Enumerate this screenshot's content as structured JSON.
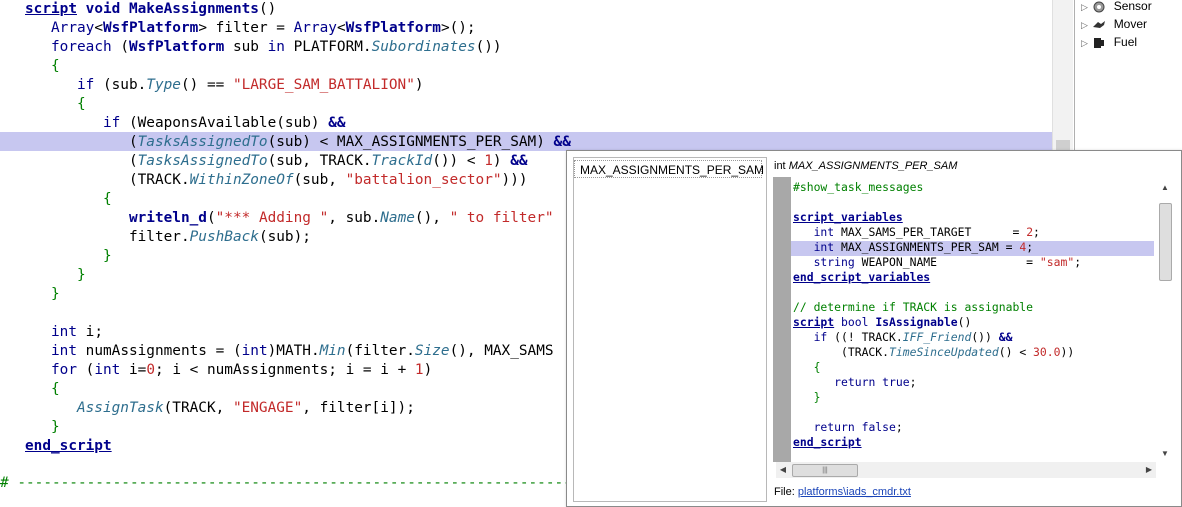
{
  "editor": {
    "lines": [
      {
        "tokens": [
          [
            "script",
            "kwu"
          ],
          [
            " ",
            "id"
          ],
          [
            "void",
            "kw"
          ],
          [
            " ",
            "id"
          ],
          [
            "MakeAssignments",
            "kw"
          ],
          [
            "()",
            "id"
          ]
        ]
      },
      {
        "tokens": [
          [
            "   ",
            "id"
          ],
          [
            "Array",
            "ty"
          ],
          [
            "<",
            "id"
          ],
          [
            "WsfPlatform",
            "kw"
          ],
          [
            "> filter = ",
            "id"
          ],
          [
            "Array",
            "ty"
          ],
          [
            "<",
            "id"
          ],
          [
            "WsfPlatform",
            "kw"
          ],
          [
            ">();",
            "id"
          ]
        ]
      },
      {
        "tokens": [
          [
            "   ",
            "id"
          ],
          [
            "foreach",
            "ty"
          ],
          [
            " (",
            "id"
          ],
          [
            "WsfPlatform",
            "kw"
          ],
          [
            " sub ",
            "id"
          ],
          [
            "in",
            "ty"
          ],
          [
            " PLATFORM.",
            "id"
          ],
          [
            "Subordinates",
            "fn"
          ],
          [
            "())",
            "id"
          ]
        ]
      },
      {
        "tokens": [
          [
            "   ",
            "id"
          ],
          [
            "{",
            "br"
          ]
        ]
      },
      {
        "tokens": [
          [
            "      ",
            "id"
          ],
          [
            "if",
            "ty"
          ],
          [
            " (sub.",
            "id"
          ],
          [
            "Type",
            "fn"
          ],
          [
            "() == ",
            "id"
          ],
          [
            "\"LARGE_SAM_BATTALION\"",
            "str"
          ],
          [
            ")",
            "id"
          ]
        ]
      },
      {
        "tokens": [
          [
            "      ",
            "id"
          ],
          [
            "{",
            "br"
          ]
        ]
      },
      {
        "tokens": [
          [
            "         ",
            "id"
          ],
          [
            "if",
            "ty"
          ],
          [
            " (",
            "id"
          ],
          [
            "WeaponsAvailable",
            "id"
          ],
          [
            "(sub) ",
            "id"
          ],
          [
            "&&",
            "kw"
          ]
        ]
      },
      {
        "tokens": [
          [
            "            (",
            "id"
          ],
          [
            "TasksAssignedTo",
            "fn"
          ],
          [
            "(sub) < MAX_ASSIGNMENTS_PER_SAM) ",
            "id"
          ],
          [
            "&&",
            "kw"
          ]
        ]
      },
      {
        "tokens": [
          [
            "            (",
            "id"
          ],
          [
            "TasksAssignedTo",
            "fn"
          ],
          [
            "(sub, TRACK.",
            "id"
          ],
          [
            "TrackId",
            "fn"
          ],
          [
            "()) < ",
            "id"
          ],
          [
            "1",
            "num"
          ],
          [
            ") ",
            "id"
          ],
          [
            "&&",
            "kw"
          ]
        ]
      },
      {
        "tokens": [
          [
            "            (TRACK.",
            "id"
          ],
          [
            "WithinZoneOf",
            "fn"
          ],
          [
            "(sub, ",
            "id"
          ],
          [
            "\"battalion_sector\"",
            "str"
          ],
          [
            ")))",
            "id"
          ]
        ]
      },
      {
        "tokens": [
          [
            "         ",
            "id"
          ],
          [
            "{",
            "br"
          ]
        ]
      },
      {
        "tokens": [
          [
            "            ",
            "id"
          ],
          [
            "writeln_d",
            "kw"
          ],
          [
            "(",
            "id"
          ],
          [
            "\"*** Adding \"",
            "str"
          ],
          [
            ", sub.",
            "id"
          ],
          [
            "Name",
            "fn"
          ],
          [
            "(), ",
            "id"
          ],
          [
            "\" to filter\"",
            "str"
          ]
        ]
      },
      {
        "tokens": [
          [
            "            filter.",
            "id"
          ],
          [
            "PushBack",
            "fn"
          ],
          [
            "(sub);",
            "id"
          ]
        ]
      },
      {
        "tokens": [
          [
            "         ",
            "id"
          ],
          [
            "}",
            "br"
          ]
        ]
      },
      {
        "tokens": [
          [
            "      ",
            "id"
          ],
          [
            "}",
            "br"
          ]
        ]
      },
      {
        "tokens": [
          [
            "   ",
            "id"
          ],
          [
            "}",
            "br"
          ]
        ]
      },
      {
        "tokens": []
      },
      {
        "tokens": [
          [
            "   ",
            "id"
          ],
          [
            "int",
            "ty"
          ],
          [
            " i;",
            "id"
          ]
        ]
      },
      {
        "tokens": [
          [
            "   ",
            "id"
          ],
          [
            "int",
            "ty"
          ],
          [
            " numAssignments = (",
            "id"
          ],
          [
            "int",
            "ty"
          ],
          [
            ")MATH.",
            "id"
          ],
          [
            "Min",
            "fn"
          ],
          [
            "(filter.",
            "id"
          ],
          [
            "Size",
            "fn"
          ],
          [
            "(), MAX_SAMS",
            "id"
          ]
        ]
      },
      {
        "tokens": [
          [
            "   ",
            "id"
          ],
          [
            "for",
            "ty"
          ],
          [
            " (",
            "id"
          ],
          [
            "int",
            "ty"
          ],
          [
            " i=",
            "id"
          ],
          [
            "0",
            "num"
          ],
          [
            "; i < numAssignments; i = i + ",
            "id"
          ],
          [
            "1",
            "num"
          ],
          [
            ")",
            "id"
          ]
        ]
      },
      {
        "tokens": [
          [
            "   ",
            "id"
          ],
          [
            "{",
            "br"
          ]
        ]
      },
      {
        "tokens": [
          [
            "      ",
            "id"
          ],
          [
            "AssignTask",
            "fn"
          ],
          [
            "(TRACK, ",
            "id"
          ],
          [
            "\"ENGAGE\"",
            "str"
          ],
          [
            ", filter[i]);",
            "id"
          ]
        ]
      },
      {
        "tokens": [
          [
            "   ",
            "id"
          ],
          [
            "}",
            "br"
          ]
        ]
      },
      {
        "tokens": [
          [
            "end_script",
            "kwu"
          ]
        ]
      }
    ],
    "separator": "# ----------------------------------------------------------------------"
  },
  "tree": {
    "items": [
      {
        "label": "Sensor",
        "icon": "sensor-icon"
      },
      {
        "label": "Mover",
        "icon": "mover-icon"
      },
      {
        "label": "Fuel",
        "icon": "fuel-icon"
      }
    ]
  },
  "popup": {
    "list_item": "MAX_ASSIGNMENTS_PER_SAM",
    "title_type": "int",
    "title_name": "MAX_ASSIGNMENTS_PER_SAM",
    "code": [
      {
        "tokens": [
          [
            "#show_task_messages",
            "cmt"
          ]
        ]
      },
      {
        "tokens": []
      },
      {
        "tokens": [
          [
            "script_variables",
            "kwu"
          ]
        ]
      },
      {
        "tokens": [
          [
            "   ",
            "id"
          ],
          [
            "int",
            "ty"
          ],
          [
            " MAX_SAMS_PER_TARGET      = ",
            "id"
          ],
          [
            "2",
            "num"
          ],
          [
            ";",
            "id"
          ]
        ]
      },
      {
        "tokens": [
          [
            "   ",
            "id"
          ],
          [
            "int",
            "ty"
          ],
          [
            " MAX_ASSIGNMENTS_PER_SAM = ",
            "id"
          ],
          [
            "4",
            "num"
          ],
          [
            ";",
            "id"
          ]
        ]
      },
      {
        "tokens": [
          [
            "   ",
            "id"
          ],
          [
            "string",
            "ty"
          ],
          [
            " WEAPON_NAME             = ",
            "id"
          ],
          [
            "\"sam\"",
            "str"
          ],
          [
            ";",
            "id"
          ]
        ]
      },
      {
        "tokens": [
          [
            "end_script_variables",
            "kwu"
          ]
        ]
      },
      {
        "tokens": []
      },
      {
        "tokens": [
          [
            "// determine if TRACK is assignable",
            "cmt"
          ]
        ]
      },
      {
        "tokens": [
          [
            "script",
            "kwu"
          ],
          [
            " ",
            "id"
          ],
          [
            "bool",
            "ty"
          ],
          [
            " ",
            "id"
          ],
          [
            "IsAssignable",
            "kw"
          ],
          [
            "()",
            "id"
          ]
        ]
      },
      {
        "tokens": [
          [
            "   ",
            "id"
          ],
          [
            "if",
            "ty"
          ],
          [
            " ((! TRACK.",
            "id"
          ],
          [
            "IFF_Friend",
            "fn"
          ],
          [
            "()) ",
            "id"
          ],
          [
            "&&",
            "kw"
          ]
        ]
      },
      {
        "tokens": [
          [
            "       (TRACK.",
            "id"
          ],
          [
            "TimeSinceUpdated",
            "fn"
          ],
          [
            "() < ",
            "id"
          ],
          [
            "30.0",
            "num"
          ],
          [
            "))",
            "id"
          ]
        ]
      },
      {
        "tokens": [
          [
            "   ",
            "id"
          ],
          [
            "{",
            "br"
          ]
        ]
      },
      {
        "tokens": [
          [
            "      ",
            "id"
          ],
          [
            "return",
            "ty"
          ],
          [
            " ",
            "id"
          ],
          [
            "true",
            "ty"
          ],
          [
            ";",
            "id"
          ]
        ]
      },
      {
        "tokens": [
          [
            "   ",
            "id"
          ],
          [
            "}",
            "br"
          ]
        ]
      },
      {
        "tokens": []
      },
      {
        "tokens": [
          [
            "   ",
            "id"
          ],
          [
            "return",
            "ty"
          ],
          [
            " ",
            "id"
          ],
          [
            "false",
            "ty"
          ],
          [
            ";",
            "id"
          ]
        ]
      },
      {
        "tokens": [
          [
            "end_script",
            "kwu"
          ]
        ]
      }
    ],
    "file_label": "File:",
    "file_link": "platforms\\iads_cmdr.txt"
  }
}
